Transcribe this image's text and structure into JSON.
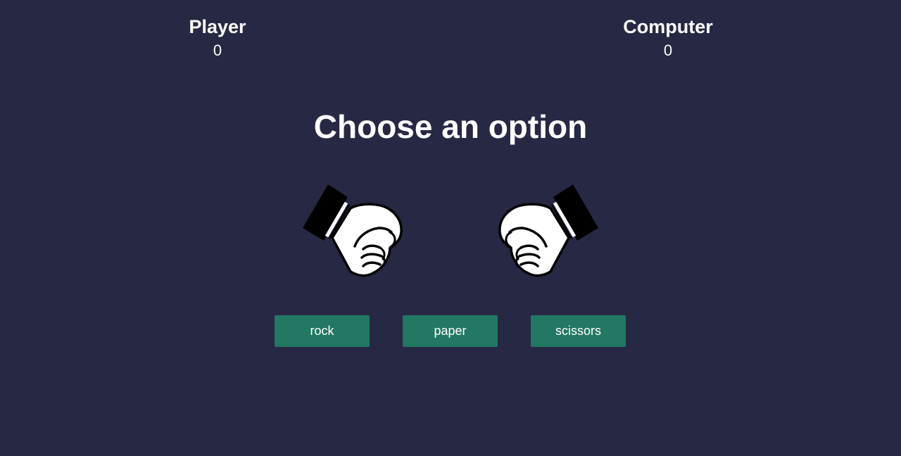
{
  "scoreboard": {
    "player": {
      "label": "Player",
      "score": "0"
    },
    "computer": {
      "label": "Computer",
      "score": "0"
    }
  },
  "prompt": "Choose an option",
  "hands": {
    "player_icon": "fist-icon",
    "computer_icon": "fist-icon"
  },
  "choices": [
    {
      "label": "rock"
    },
    {
      "label": "paper"
    },
    {
      "label": "scissors"
    }
  ],
  "colors": {
    "background": "#272844",
    "button": "#227863",
    "text": "#ffffff"
  }
}
